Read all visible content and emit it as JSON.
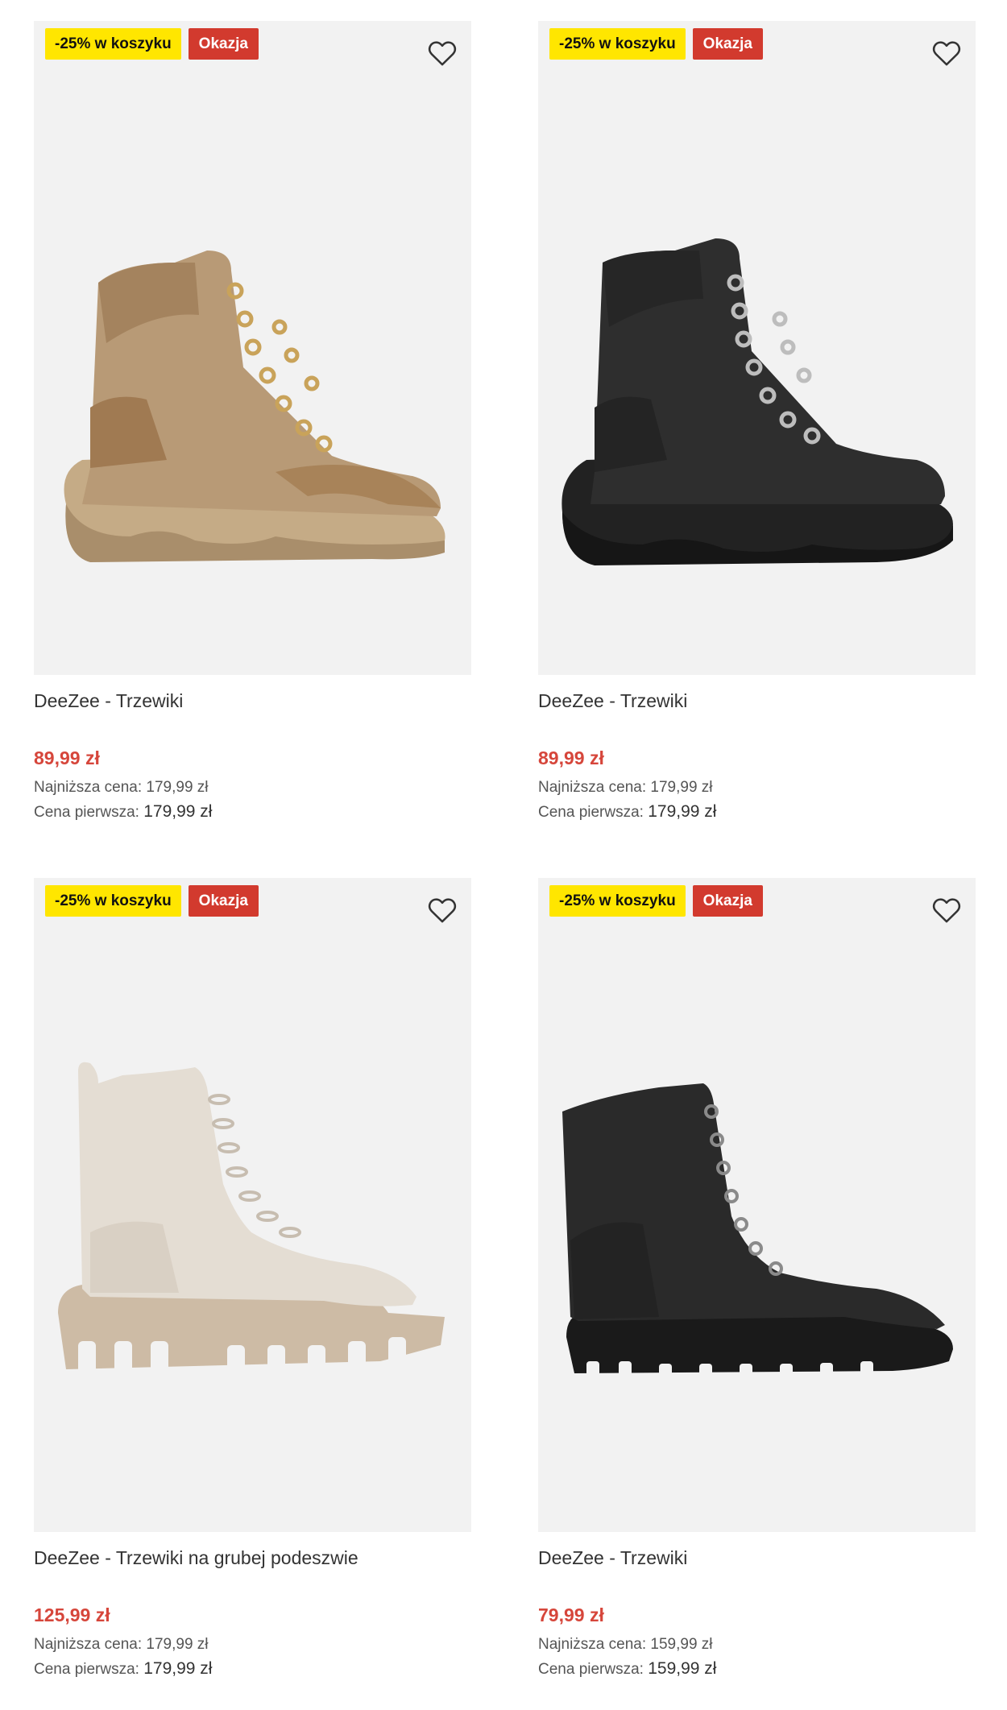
{
  "products": [
    {
      "badge_discount": "-25% w koszyku",
      "badge_deal": "Okazja",
      "name": "DeeZee - Trzewiki",
      "price": "89,99 zł",
      "lowest_label": "Najniższa cena:",
      "lowest_value": "179,99 zł",
      "first_label": "Cena pierwsza:",
      "first_value": "179,99 zł",
      "boot_color": "#b89a76"
    },
    {
      "badge_discount": "-25% w koszyku",
      "badge_deal": "Okazja",
      "name": "DeeZee - Trzewiki",
      "price": "89,99 zł",
      "lowest_label": "Najniższa cena:",
      "lowest_value": "179,99 zł",
      "first_label": "Cena pierwsza:",
      "first_value": "179,99 zł",
      "boot_color": "#2b2b2b"
    },
    {
      "badge_discount": "-25% w koszyku",
      "badge_deal": "Okazja",
      "name": "DeeZee - Trzewiki na grubej podeszwie",
      "price": "125,99 zł",
      "lowest_label": "Najniższa cena:",
      "lowest_value": "179,99 zł",
      "first_label": "Cena pierwsza:",
      "first_value": "179,99 zł",
      "boot_color": "#e4ddd3"
    },
    {
      "badge_discount": "-25% w koszyku",
      "badge_deal": "Okazja",
      "name": "DeeZee - Trzewiki",
      "price": "79,99 zł",
      "lowest_label": "Najniższa cena:",
      "lowest_value": "159,99 zł",
      "first_label": "Cena pierwsza:",
      "first_value": "159,99 zł",
      "boot_color": "#1e1e1e"
    }
  ],
  "icons": {
    "favorite": "heart-outline-icon"
  },
  "colors": {
    "price": "#d6463b",
    "discount_badge": "#ffe600",
    "deal_badge": "#d23a2e"
  }
}
